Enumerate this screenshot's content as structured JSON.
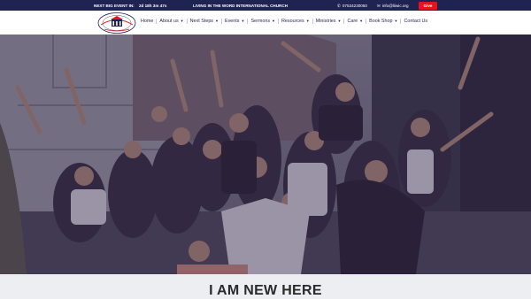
{
  "topbar": {
    "event_label": "NEXT BIG EVENT IN:",
    "countdown": "2d 18h 3m 47s",
    "church_name": "LIVING IN THE WORD INTERNATIONAL CHURCH",
    "phone": "07534230050",
    "email": "info@liiwic.org",
    "give_label": "Give"
  },
  "nav": {
    "items": [
      {
        "label": "Home",
        "dropdown": false
      },
      {
        "label": "About us",
        "dropdown": true
      },
      {
        "label": "Next Steps",
        "dropdown": true
      },
      {
        "label": "Events",
        "dropdown": true
      },
      {
        "label": "Sermons",
        "dropdown": true
      },
      {
        "label": "Resources",
        "dropdown": true
      },
      {
        "label": "Ministries",
        "dropdown": true
      },
      {
        "label": "Care",
        "dropdown": true
      },
      {
        "label": "Book Shop",
        "dropdown": true
      },
      {
        "label": "Contact Us",
        "dropdown": false
      }
    ]
  },
  "section": {
    "heading": "I AM NEW HERE"
  },
  "colors": {
    "topbar_bg": "#1e2352",
    "accent_red": "#e8121c",
    "nav_text": "#1e2352"
  },
  "icons": {
    "phone": "phone-icon",
    "email": "envelope-icon"
  }
}
